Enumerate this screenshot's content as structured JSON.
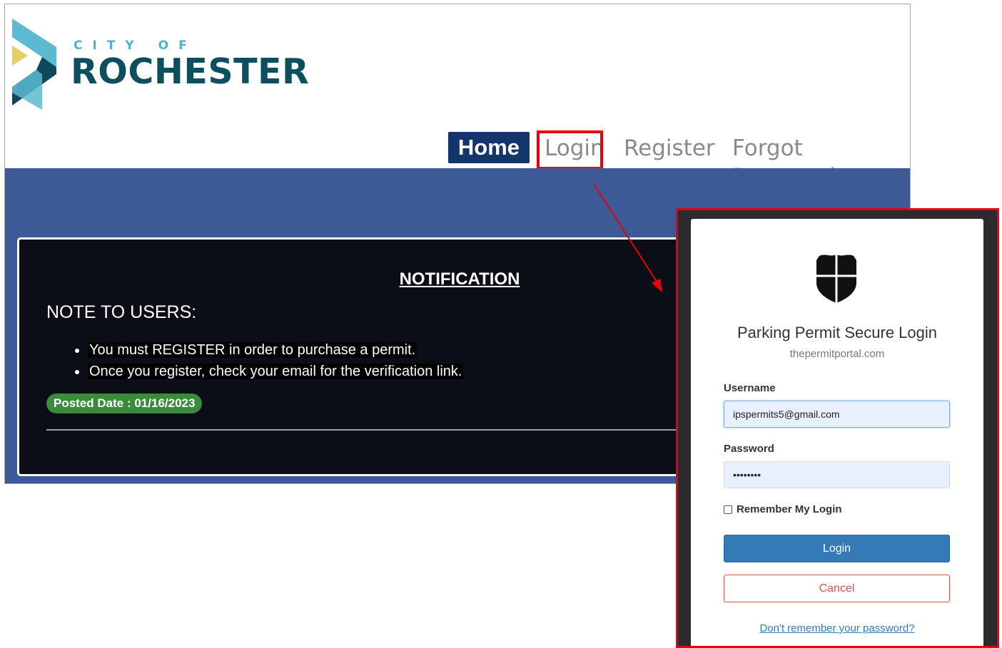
{
  "site": {
    "logo": {
      "line1": "CITY OF",
      "line2": "ROCHESTER"
    },
    "nav": {
      "home": "Home",
      "login": "Login",
      "register": "Register",
      "forgot": "Forgot Password"
    },
    "notice": {
      "title": "NOTIFICATION",
      "heading": "NOTE TO USERS:",
      "items": [
        "You must REGISTER in order to purchase a permit.",
        "Once you register, check your email for the verification link."
      ],
      "posted": "Posted Date : 01/16/2023"
    }
  },
  "popup": {
    "title": "Parking Permit Secure Login",
    "subtitle": "thepermitportal.com",
    "username_label": "Username",
    "username_value": "ipspermits5@gmail.com",
    "password_label": "Password",
    "password_value": "••••••••",
    "remember_label": "Remember My Login",
    "login_button": "Login",
    "cancel_button": "Cancel",
    "forgot_link": "Don't remember your password?"
  },
  "colors": {
    "nav_home_bg": "#14356b",
    "band": "#3c5a96",
    "highlight": "#e8000c",
    "primary": "#337ab7",
    "danger": "#d9534f",
    "posted_badge": "#3b8b3c"
  },
  "icons": {
    "logo": "chevron-logo-icon",
    "popup": "shield-icon"
  }
}
